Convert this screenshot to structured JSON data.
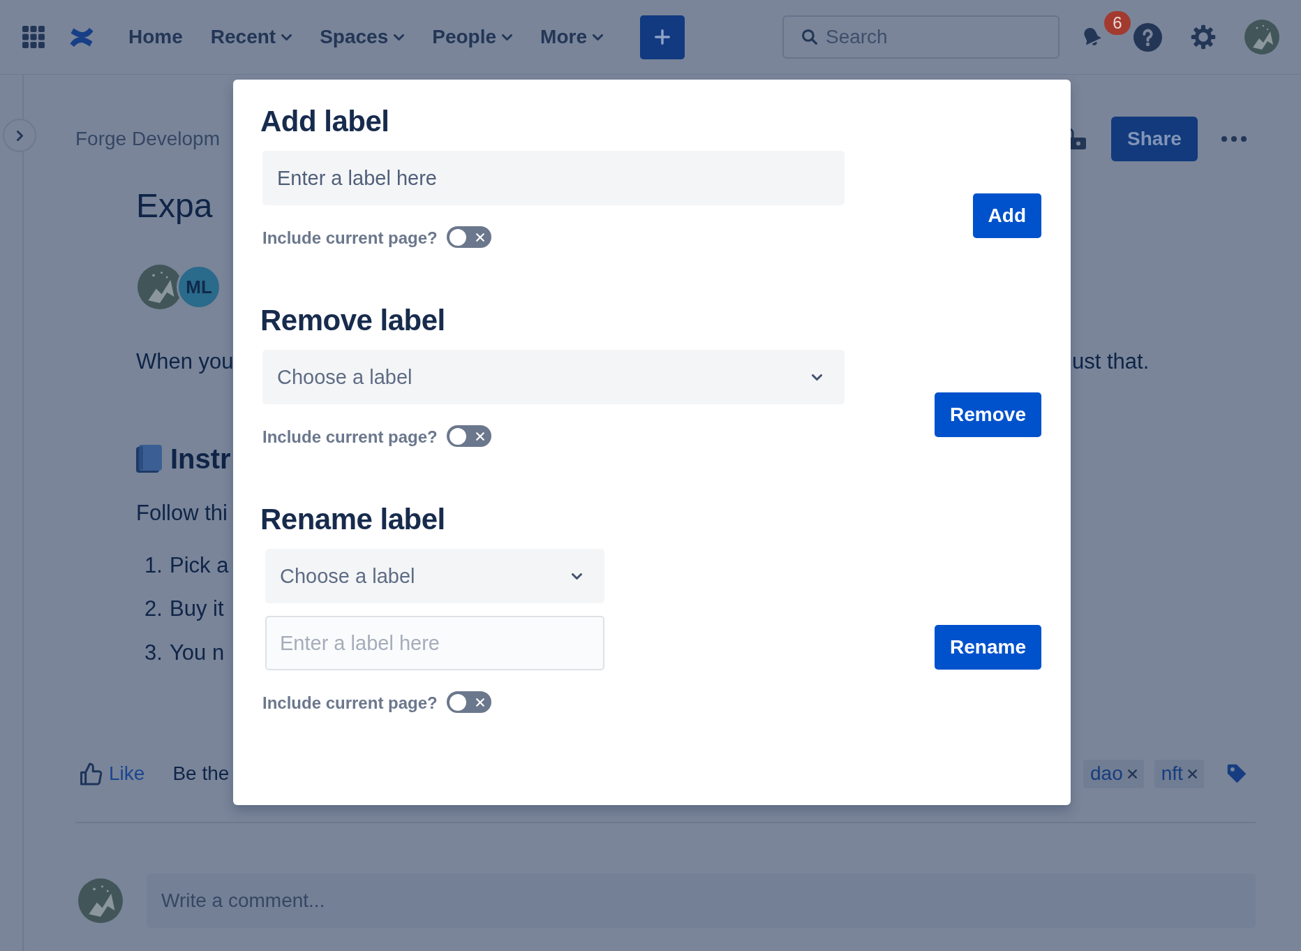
{
  "top_nav": {
    "items": [
      {
        "label": "Home",
        "has_menu": false
      },
      {
        "label": "Recent",
        "has_menu": true
      },
      {
        "label": "Spaces",
        "has_menu": true
      },
      {
        "label": "People",
        "has_menu": true
      },
      {
        "label": "More",
        "has_menu": true
      }
    ],
    "search": {
      "placeholder": "Search"
    },
    "notification_count": "6"
  },
  "page": {
    "breadcrumb": "Forge Developm",
    "title": "Expa",
    "avatar_initials": "ML",
    "share_button": "Share",
    "paragraph": {
      "start": "When you",
      "end": "ust that."
    },
    "section_heading": "Instr",
    "intro": "Follow thi",
    "steps": [
      {
        "number": "1.",
        "text": "Pick a"
      },
      {
        "number": "2.",
        "text": "Buy it"
      },
      {
        "number": "3.",
        "text": "You n"
      }
    ],
    "like": "Like",
    "like_prompt": "Be the",
    "labels": [
      "dao",
      "nft"
    ],
    "comment": {
      "placeholder": "Write a comment..."
    }
  },
  "dialog": {
    "sections": [
      {
        "title": "Add label",
        "fields": [
          {
            "kind": "filled",
            "placeholder": "Enter a label here"
          }
        ],
        "toggle": {
          "label": "Include current page?",
          "on": false
        },
        "button": "Add"
      },
      {
        "title": "Remove label",
        "fields": [
          {
            "kind": "select",
            "placeholder": "Choose a label"
          }
        ],
        "toggle": {
          "label": "Include current page?",
          "on": false
        },
        "button": "Remove"
      },
      {
        "title": "Rename label",
        "fields": [
          {
            "kind": "select",
            "placeholder": "Choose a label"
          },
          {
            "kind": "outlined",
            "placeholder": "Enter a label here"
          }
        ],
        "toggle": {
          "label": "Include current page?",
          "on": false
        },
        "button": "Rename"
      }
    ]
  }
}
